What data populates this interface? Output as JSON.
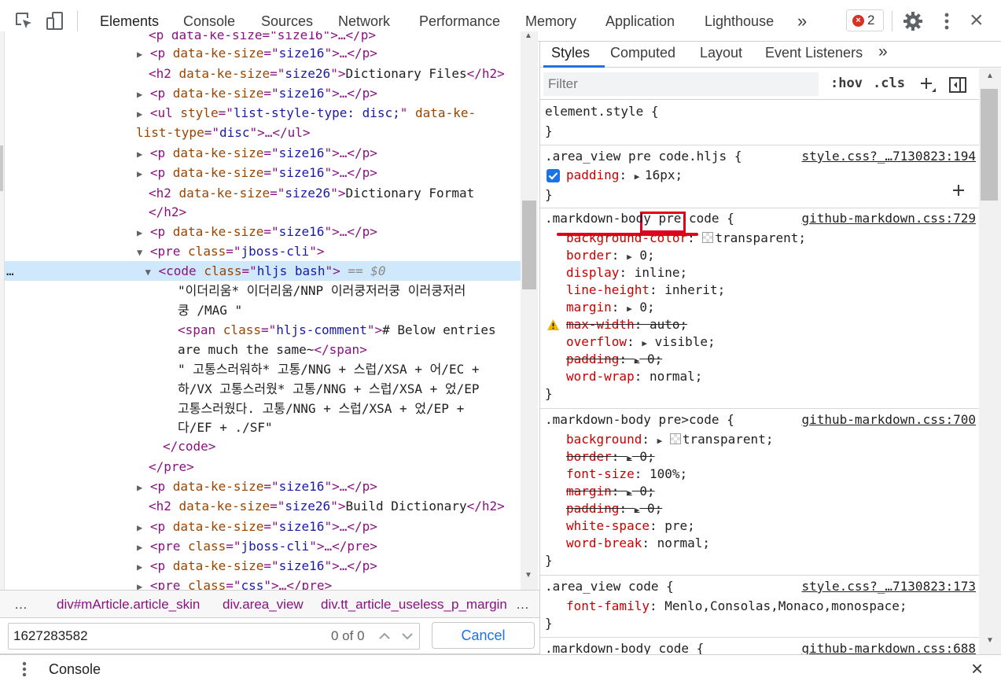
{
  "toolbar": {
    "tabs": [
      "Elements",
      "Console",
      "Sources",
      "Network",
      "Performance",
      "Memory",
      "Application",
      "Lighthouse"
    ],
    "more": "»",
    "error_count": "2",
    "close": "×"
  },
  "dom": {
    "lines": {
      "l0": "<p data-ke-size=\"size16\">…</p>",
      "l1": {
        "a": "<p ",
        "b": "data-ke-size",
        "c": "=\"",
        "d": "size16",
        "e": "\">…</p>"
      },
      "l2": {
        "a": "<h2 ",
        "b": "data-ke-size",
        "c": "=\"",
        "d": "size26",
        "e": "\">",
        "f": "Dictionary Files",
        "g": "</h2>"
      },
      "l3": {
        "a": "<p ",
        "b": "data-ke-size",
        "c": "=\"",
        "d": "size16",
        "e": "\">…</p>"
      },
      "l4": {
        "a": "<ul ",
        "b": "style",
        "c": "=\"",
        "d": "list-style-type: disc;",
        "e": "\" ",
        "f": "data-ke-"
      },
      "l5": {
        "a": "list-type",
        "b": "=\"",
        "c": "disc",
        "d": "\">…</ul>"
      },
      "l6": {
        "a": "<p ",
        "b": "data-ke-size",
        "c": "=\"",
        "d": "size16",
        "e": "\">…</p>"
      },
      "l7": {
        "a": "<p ",
        "b": "data-ke-size",
        "c": "=\"",
        "d": "size16",
        "e": "\">…</p>"
      },
      "l8": {
        "a": "<h2 ",
        "b": "data-ke-size",
        "c": "=\"",
        "d": "size26",
        "e": "\">",
        "f": "Dictionary Format"
      },
      "l9": "</h2>",
      "l10": {
        "a": "<p ",
        "b": "data-ke-size",
        "c": "=\"",
        "d": "size16",
        "e": "\">…</p>"
      },
      "l11": {
        "a": "<pre ",
        "b": "class",
        "c": "=\"",
        "d": "jboss-cli",
        "e": "\">"
      },
      "l12": {
        "dots": "…",
        "a": "<code ",
        "b": "class",
        "c": "=\"",
        "d": "hljs bash",
        "e": "\">",
        "f": " == $0"
      },
      "l13": "\"이더리움* 이더리움/NNP 이러쿵저러쿵 이러쿵저러",
      "l14": "쿵 /MAG \"",
      "l15": {
        "a": "<span ",
        "b": "class",
        "c": "=\"",
        "d": "hljs-comment",
        "e": "\">",
        "f": "# Below entries"
      },
      "l16": {
        "a": "are much the same~",
        "b": "</span>"
      },
      "l17": "\" 고통스러워하* 고통/NNG + 스럽/XSA + 어/EC +",
      "l18": "하/VX 고통스러웠* 고통/NNG + 스럽/XSA + 었/EP",
      "l19": "고통스러웠다. 고통/NNG + 스럽/XSA + 었/EP +",
      "l20": "다/EF + ./SF\"",
      "l21": "</code>",
      "l22": "</pre>",
      "l23": {
        "a": "<p ",
        "b": "data-ke-size",
        "c": "=\"",
        "d": "size16",
        "e": "\">…</p>"
      },
      "l24": {
        "a": "<h2 ",
        "b": "data-ke-size",
        "c": "=\"",
        "d": "size26",
        "e": "\">",
        "f": "Build Dictionary",
        "g": "</h2>"
      },
      "l25": {
        "a": "<p ",
        "b": "data-ke-size",
        "c": "=\"",
        "d": "size16",
        "e": "\">…</p>"
      },
      "l26": {
        "a": "<pre ",
        "b": "class",
        "c": "=\"",
        "d": "jboss-cli",
        "e": "\">…</pre>"
      },
      "l27": {
        "a": "<p ",
        "b": "data-ke-size",
        "c": "=\"",
        "d": "size16",
        "e": "\">…</p>"
      },
      "l28": {
        "a": "<pre ",
        "b": "class",
        "c": "=\"",
        "d": "css",
        "e": "\">…</pre>"
      }
    }
  },
  "breadcrumbs": {
    "lead": "…",
    "c1_tag": "div#mArticle",
    "c1_cls": ".article_skin",
    "c2_tag": "div",
    "c2_cls": ".area_view",
    "c3_tag": "div",
    "c3_cls": ".tt_article_useless_p_margin",
    "more": "…"
  },
  "search": {
    "value": "1627283582",
    "count": "0 of 0",
    "cancel": "Cancel"
  },
  "styles": {
    "tabs": [
      "Styles",
      "Computed",
      "Layout",
      "Event Listeners"
    ],
    "more": "»",
    "filter_placeholder": "Filter",
    "hov": ":hov",
    "cls": ".cls",
    "rules": {
      "r0": {
        "selector": "element.style {",
        "close": "}"
      },
      "r1": {
        "selector": ".area_view pre code.hljs {",
        "source": "style.css?_…7130823:194",
        "p_name": "padding",
        "p_val": "16px;",
        "close": "}"
      },
      "r2": {
        "selector": ".markdown-body pre code {",
        "source": "github-markdown.css:729",
        "p1n": "background-color",
        "p1v": "transparent;",
        "p2n": "border",
        "p2v": "0;",
        "p3n": "display",
        "p3v": "inline;",
        "p4n": "line-height",
        "p4v": "inherit;",
        "p5n": "margin",
        "p5v": "0;",
        "p6n": "max-width",
        "p6v": "auto;",
        "p7n": "overflow",
        "p7v": "visible;",
        "p8n": "padding",
        "p8v": "0;",
        "p9n": "word-wrap",
        "p9v": "normal;",
        "close": "}"
      },
      "r3": {
        "selector": ".markdown-body pre>code {",
        "source": "github-markdown.css:700",
        "p1n": "background",
        "p1v": "transparent;",
        "p2n": "border",
        "p2v": "0;",
        "p3n": "font-size",
        "p3v": "100%;",
        "p4n": "margin",
        "p4v": "0;",
        "p5n": "padding",
        "p5v": "0;",
        "p6n": "white-space",
        "p6v": "pre;",
        "p7n": "word-break",
        "p7v": "normal;",
        "close": "}"
      },
      "r4": {
        "selector": ".area_view code {",
        "source": "style.css?_…7130823:173",
        "p1n": "font-family",
        "p1v": "Menlo,Consolas,Monaco,monospace;",
        "close": "}"
      },
      "r5": {
        "selector": ".markdown-body code {",
        "source": "github-markdown.css:688"
      }
    }
  },
  "drawer": {
    "label": "Console",
    "close": "×"
  },
  "colors": {
    "accent": "#1a73e8",
    "highlight": "#e0001b",
    "selected_row": "#cfe8fc"
  }
}
